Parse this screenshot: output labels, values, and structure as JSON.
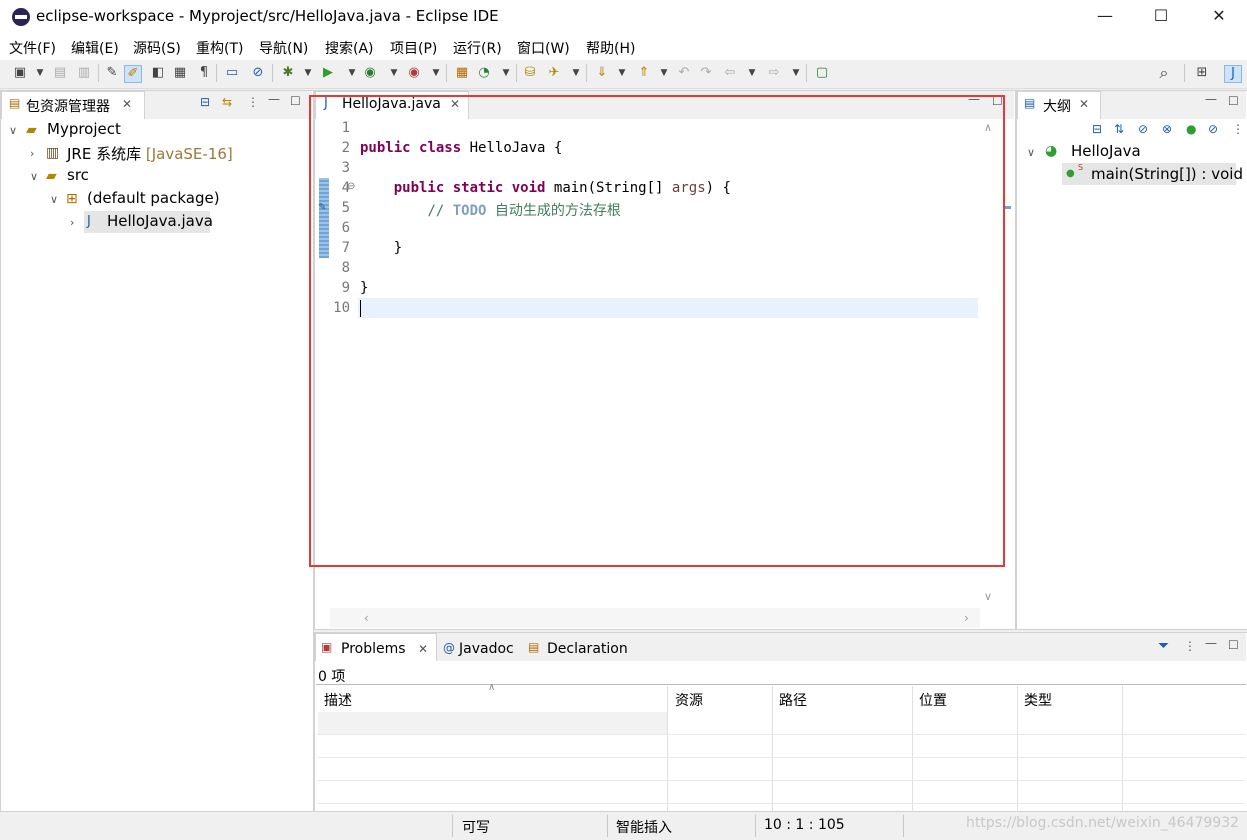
{
  "window": {
    "title": "eclipse-workspace - Myproject/src/HelloJava.java - Eclipse IDE",
    "minimize": "—",
    "maximize": "☐",
    "close": "✕"
  },
  "menu": [
    "文件(F)",
    "编辑(E)",
    "源码(S)",
    "重构(T)",
    "导航(N)",
    "搜索(A)",
    "项目(P)",
    "运行(R)",
    "窗口(W)",
    "帮助(H)"
  ],
  "package_explorer": {
    "title": "包资源管理器",
    "tree": {
      "project": "Myproject",
      "jre": "JRE 系统库",
      "jre_version": "[JavaSE-16]",
      "src": "src",
      "package": "(default package)",
      "file": "HelloJava.java"
    }
  },
  "editor": {
    "tab": "HelloJava.java",
    "line_numbers": [
      "1",
      "2",
      "3",
      "4",
      "5",
      "6",
      "7",
      "8",
      "9",
      "10"
    ],
    "code": {
      "l2_kw1": "public",
      "l2_kw2": "class",
      "l2_rest": " HelloJava {",
      "l4_kw1": "public",
      "l4_kw2": "static",
      "l4_kw3": "void",
      "l4_mid": " main(String[] ",
      "l4_var": "args",
      "l4_end": ") {",
      "l5_comment": "// ",
      "l5_todo": "TODO",
      "l5_text": " 自动生成的方法存根",
      "l7": "}",
      "l9": "}"
    }
  },
  "outline": {
    "title": "大纲",
    "class_name": "HelloJava",
    "method": "main(String[]) : void"
  },
  "bottom": {
    "tabs": {
      "problems": "Problems",
      "javadoc": "Javadoc",
      "declaration": "Declaration"
    },
    "count": "0 项",
    "columns": [
      "描述",
      "资源",
      "路径",
      "位置",
      "类型"
    ]
  },
  "status": {
    "writable": "可写",
    "insert_mode": "智能插入",
    "position": "10 : 1 : 105",
    "watermark": "https://blog.csdn.net/weixin_46479932"
  },
  "colors": {
    "highlight_box": "#e53935",
    "keyword": "#7f0055",
    "comment": "#3f7f5f",
    "current_line": "#e8f2fe"
  }
}
